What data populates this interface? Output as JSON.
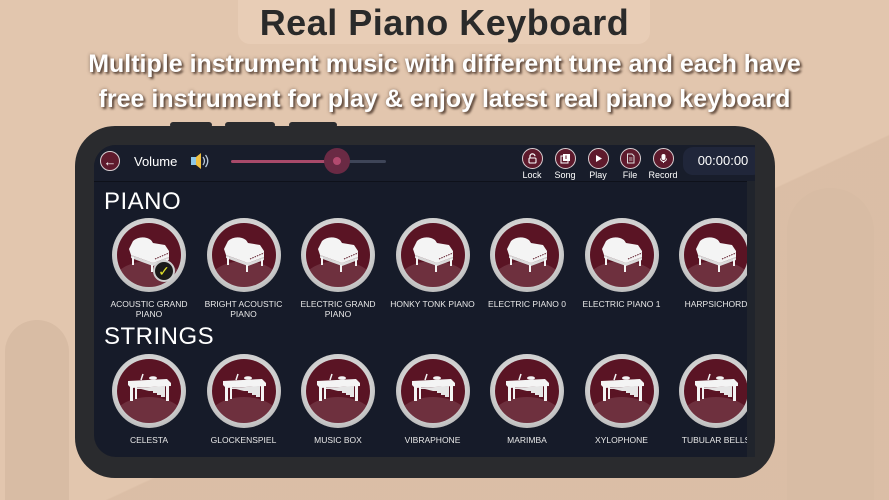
{
  "promo": {
    "title": "Real Piano Keyboard",
    "subtitle_line1": "Multiple instrument music with different tune and each have",
    "subtitle_line2": "free instrument for play & enjoy latest real piano keyboard"
  },
  "topbar": {
    "back_icon": "arrow-left-icon",
    "volume_label": "Volume",
    "volume_icon": "speaker-icon",
    "volume_level_percent": 67,
    "tools": [
      {
        "label": "Lock",
        "icon": "lock-icon"
      },
      {
        "label": "Song",
        "icon": "song-icon"
      },
      {
        "label": "Play",
        "icon": "play-icon"
      },
      {
        "label": "File",
        "icon": "file-icon"
      },
      {
        "label": "Record",
        "icon": "microphone-icon"
      }
    ],
    "timer": "00:00:00"
  },
  "sections": [
    {
      "title": "PIANO",
      "icon": "grand-piano-icon",
      "items": [
        {
          "name": "ACOUSTIC GRAND PIANO",
          "selected": true
        },
        {
          "name": "BRIGHT ACOUSTIC PIANO",
          "selected": false
        },
        {
          "name": "ELECTRIC GRAND PIANO",
          "selected": false
        },
        {
          "name": "HONKY TONK PIANO",
          "selected": false
        },
        {
          "name": "ELECTRIC PIANO 0",
          "selected": false
        },
        {
          "name": "ELECTRIC PIANO 1",
          "selected": false
        },
        {
          "name": "HARPSICHORD",
          "selected": false
        }
      ]
    },
    {
      "title": "STRINGS",
      "icon": "xylophone-icon",
      "items": [
        {
          "name": "CELESTA",
          "selected": false
        },
        {
          "name": "GLOCKENSPIEL",
          "selected": false
        },
        {
          "name": "MUSIC BOX",
          "selected": false
        },
        {
          "name": "VIBRAPHONE",
          "selected": false
        },
        {
          "name": "MARIMBA",
          "selected": false
        },
        {
          "name": "XYLOPHONE",
          "selected": false
        },
        {
          "name": "TUBULAR BELLS",
          "selected": false
        }
      ]
    }
  ],
  "selected_check_icon": "checkmark-icon",
  "colors": {
    "accent": "#5e1a2c",
    "screen_bg": "#161b29",
    "page_bg": "#e2c6ae",
    "slider_fill": "#a84a6a",
    "check": "#e6e62a"
  }
}
